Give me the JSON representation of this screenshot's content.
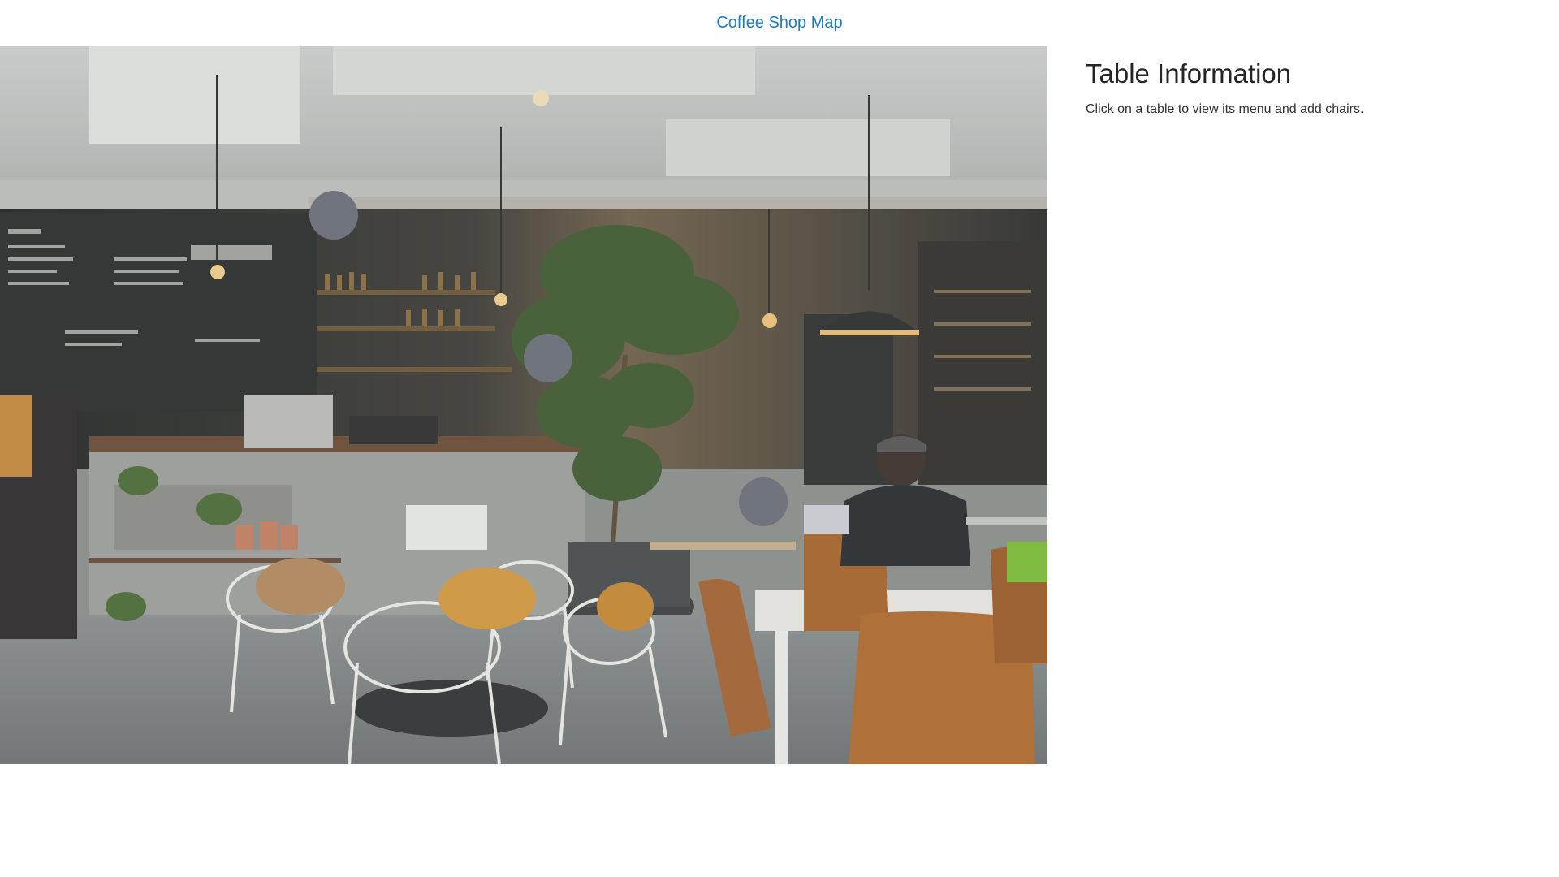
{
  "header": {
    "title": "Coffee Shop Map",
    "title_color": "#1a7dc4"
  },
  "map": {
    "image_description_icon": "coffee-shop-interior-photo",
    "table_marker_color": "#70757d",
    "tables": [
      {
        "id": "table-1"
      },
      {
        "id": "table-2"
      },
      {
        "id": "table-3"
      }
    ]
  },
  "info_panel": {
    "title": "Table Information",
    "instructions": "Click on a table to view its menu and add chairs."
  }
}
